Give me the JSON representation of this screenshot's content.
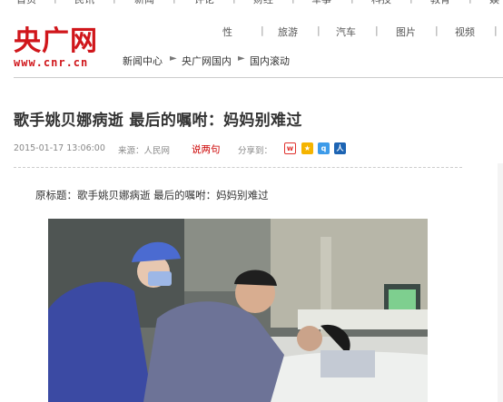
{
  "top_nav": [
    "首页",
    "民讯",
    "新闻",
    "评论",
    "财经",
    "军事",
    "科技",
    "教育",
    "娱"
  ],
  "logo": {
    "cn": "央广网",
    "url": "www.cnr.cn"
  },
  "section_nav": [
    "性",
    "旅游",
    "汽车",
    "图片",
    "视频"
  ],
  "breadcrumb": [
    "新闻中心",
    "央广网国内",
    "国内滚动"
  ],
  "article": {
    "title": "歌手姚贝娜病逝  最后的嘱咐：妈妈别难过",
    "date": "2015-01-17 13:06:00",
    "source": "来源：人民网",
    "comment_link": "说两句",
    "share_label": "分享到：",
    "original_title": "原标题：歌手姚贝娜病逝 最后的嘱咐：妈妈别难过"
  },
  "colors": {
    "brand_red": "#d0161b",
    "link_red": "#cc0000"
  },
  "share_icons": [
    "weibo-icon",
    "qzone-icon",
    "qq-icon",
    "renren-icon"
  ]
}
